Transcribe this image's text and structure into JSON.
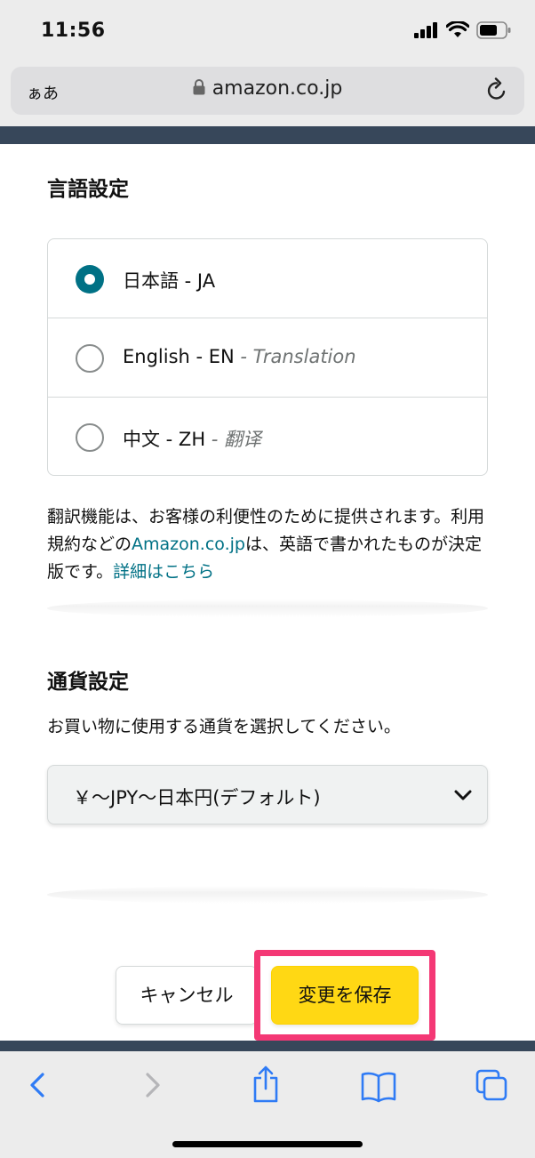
{
  "status_bar": {
    "time": "11:56"
  },
  "browser": {
    "text_size_label": "ぁあ",
    "url": "amazon.co.jp"
  },
  "language_settings": {
    "title": "言語設定",
    "options": [
      {
        "label": "日本語 - JA",
        "note": "",
        "selected": true
      },
      {
        "label": "English - EN",
        "note": "- Translation",
        "selected": false
      },
      {
        "label": "中文 - ZH",
        "note": "- 翻译",
        "selected": false
      }
    ],
    "note_text_1": "翻訳機能は、お客様の利便性のために提供されます。利用規約などの",
    "note_link_1": "Amazon.co.jp",
    "note_text_2": "は、英語で書かれたものが決定版です。",
    "note_link_2": "詳細はこちら"
  },
  "currency_settings": {
    "title": "通貨設定",
    "description": "お買い物に使用する通貨を選択してください。",
    "selected_currency": "￥～JPY～日本円(デフォルト)"
  },
  "actions": {
    "cancel_label": "キャンセル",
    "save_label": "変更を保存"
  },
  "colors": {
    "accent_teal": "#007185",
    "save_yellow": "#ffd814",
    "highlight_pink": "#f43875",
    "header_dark": "#37475a",
    "ios_blue": "#2f7bf5"
  }
}
